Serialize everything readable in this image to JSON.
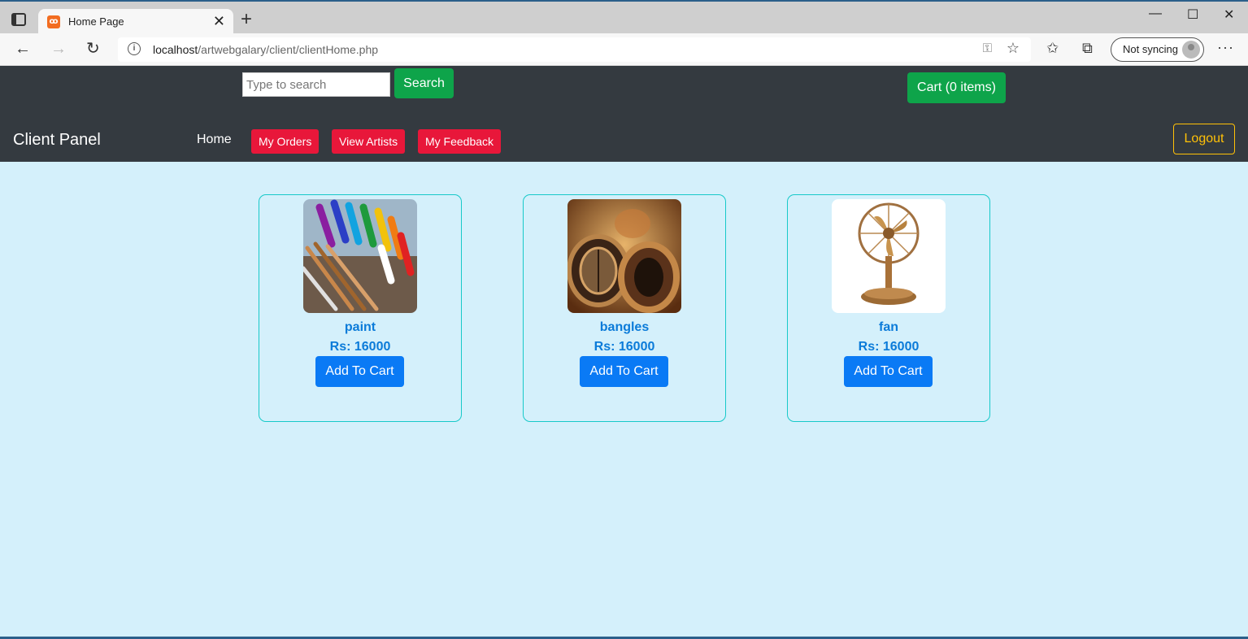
{
  "browser": {
    "tab_title": "Home Page",
    "tab_favicon": "xampp-icon",
    "url_host": "localhost",
    "url_path": "/artwebgalary/client/clientHome.php",
    "sync_label": "Not syncing"
  },
  "header": {
    "search_placeholder": "Type to search",
    "search_label": "Search",
    "cart_label": "Cart (0 items)",
    "brand": "Client Panel",
    "nav": {
      "home": "Home",
      "orders": "My Orders",
      "artists": "View Artists",
      "feedback": "My Feedback"
    },
    "logout_label": "Logout"
  },
  "colors": {
    "header_bg": "#343a40",
    "page_bg": "#d4f0fb",
    "success": "#0ea44a",
    "danger": "#e8173a",
    "warning": "#ffc107",
    "primary": "#0a7af5",
    "card_border": "#17c9c9"
  },
  "products": [
    {
      "name": "paint",
      "price": "Rs: 16000",
      "button": "Add To Cart",
      "image": "paint-tubes-image"
    },
    {
      "name": "bangles",
      "price": "Rs: 16000",
      "button": "Add To Cart",
      "image": "bangles-image"
    },
    {
      "name": "fan",
      "price": "Rs: 16000",
      "button": "Add To Cart",
      "image": "brass-fan-image"
    }
  ]
}
